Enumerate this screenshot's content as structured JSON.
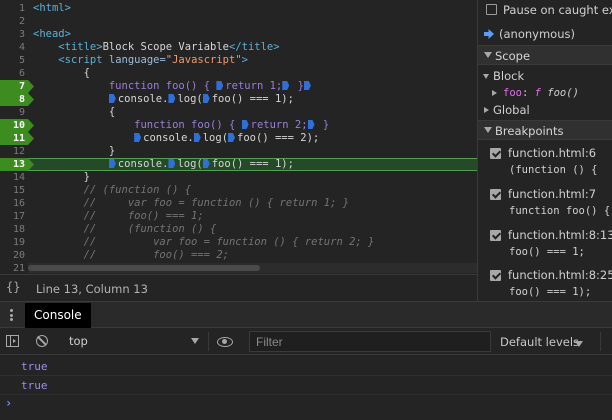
{
  "editor": {
    "lines": [
      {
        "num": "1",
        "bp": false,
        "current": false
      },
      {
        "num": "2",
        "bp": false,
        "current": false
      },
      {
        "num": "3",
        "bp": false,
        "current": false
      },
      {
        "num": "4",
        "bp": false,
        "current": false
      },
      {
        "num": "5",
        "bp": false,
        "current": false
      },
      {
        "num": "6",
        "bp": false,
        "current": false
      },
      {
        "num": "7",
        "bp": true,
        "current": false
      },
      {
        "num": "8",
        "bp": true,
        "current": false
      },
      {
        "num": "9",
        "bp": false,
        "current": false
      },
      {
        "num": "10",
        "bp": true,
        "current": false
      },
      {
        "num": "11",
        "bp": true,
        "current": false
      },
      {
        "num": "12",
        "bp": false,
        "current": false
      },
      {
        "num": "13",
        "bp": true,
        "current": true
      },
      {
        "num": "14",
        "bp": false,
        "current": false
      },
      {
        "num": "15",
        "bp": false,
        "current": false
      },
      {
        "num": "16",
        "bp": false,
        "current": false
      },
      {
        "num": "17",
        "bp": false,
        "current": false
      },
      {
        "num": "18",
        "bp": false,
        "current": false
      },
      {
        "num": "19",
        "bp": false,
        "current": false
      },
      {
        "num": "20",
        "bp": false,
        "current": false
      },
      {
        "num": "21",
        "bp": false,
        "current": false
      }
    ],
    "code": {
      "l1": "<html>",
      "l3": "<head>",
      "l4_open": "<title>",
      "l4_text": "Block Scope Variable",
      "l4_close": "</title>",
      "l5_tag": "<script",
      "l5_attr": " language=",
      "l5_str": "\"Javascript\"",
      "l5_end": ">",
      "l6": "{",
      "l7_kw": "function",
      "l7_a": " foo() { ",
      "l7_ret": "return",
      "l7_b": " 1;",
      "l7_c": " }",
      "l8_a": "console.",
      "l8_b": "log(",
      "l8_c": "foo() === 1);",
      "l9": "{",
      "l10_kw": "function",
      "l10_a": " foo() { ",
      "l10_ret": "return",
      "l10_b": " 2;",
      "l10_c": " }",
      "l11_a": "console.",
      "l11_b": "log(",
      "l11_c": "foo() === 2);",
      "l12": "}",
      "l13_a": "console.",
      "l13_b": "log(",
      "l13_c": "foo() === 1);",
      "l14": "}",
      "l15": "// (function () {",
      "l16": "//     var foo = function () { return 1; }",
      "l17": "//     foo() === 1;",
      "l18": "//     (function () {",
      "l19": "//         var foo = function () { return 2; }",
      "l20": "//         foo() === 2;"
    }
  },
  "status": {
    "braces": "{}",
    "position": "Line 13, Column 13"
  },
  "sidebar": {
    "pause_caught": "Pause on caught exceptions",
    "frame": "(anonymous)",
    "scope_title": "Scope",
    "block_label": "Block",
    "foo_name": "foo",
    "foo_colon": ":",
    "foo_f": "f",
    "foo_value": "foo()",
    "global_label": "Global",
    "breakpoints_title": "Breakpoints",
    "breakpoints": [
      {
        "file": "function.html:6",
        "code": "(function () {"
      },
      {
        "file": "function.html:7",
        "code": "function foo() {"
      },
      {
        "file": "function.html:8:13",
        "code": "foo() === 1;"
      },
      {
        "file": "function.html:8:25",
        "code": "foo() === 1);"
      }
    ]
  },
  "drawer": {
    "tab_console": "Console",
    "context": "top",
    "filter_placeholder": "Filter",
    "levels": "Default levels"
  },
  "console": {
    "outputs": [
      "true",
      "true"
    ],
    "prompt": "›"
  },
  "colors": {
    "breakpoint": "#3c8c1f",
    "current_line": "#244a27",
    "accent_blue": "#5b9cf5"
  }
}
